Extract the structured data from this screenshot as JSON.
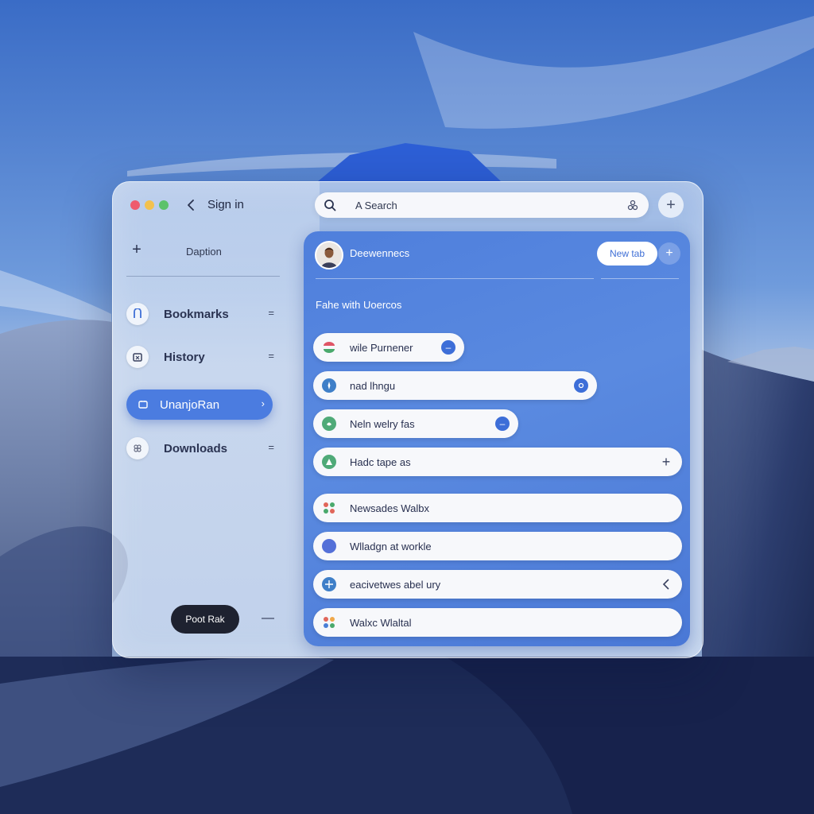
{
  "window": {
    "signin_label": "Sign in"
  },
  "sidebar": {
    "title": "Daption",
    "items": [
      {
        "label": "Bookmarks",
        "icon": "bookmark-icon",
        "trail": "="
      },
      {
        "label": "History",
        "icon": "history-icon",
        "trail": "="
      },
      {
        "label": "UnanjoRan",
        "icon": "folder-icon",
        "trail": "›"
      },
      {
        "label": "Downloads",
        "icon": "download-icon",
        "trail": "="
      }
    ],
    "post_button": "Poot Rak"
  },
  "search": {
    "placeholder": "A Search"
  },
  "panel": {
    "title": "Deewennecs",
    "new_tab_label": "New tab",
    "section_heading": "Fahe with Uoercos",
    "rows": [
      {
        "label": "wile Purnener",
        "icon": "chrome-icon",
        "action": "minus-icon"
      },
      {
        "label": "nad lhngu",
        "icon": "compass-icon",
        "action": "target-icon"
      },
      {
        "label": "Neln welry fas",
        "icon": "leaf-icon",
        "action": "minus-icon"
      },
      {
        "label": "Hadc tape as",
        "icon": "triangle-icon",
        "action": "plus-icon"
      },
      {
        "label": "Newsades Walbx",
        "icon": "apps-icon",
        "action": ""
      },
      {
        "label": "Wlladgn at workle",
        "icon": "circle-icon",
        "action": ""
      },
      {
        "label": "eacivetwes abel ury",
        "icon": "compass-icon",
        "action": "chevron-left-icon"
      },
      {
        "label": "Walxc Wlaltal",
        "icon": "apps-icon",
        "action": ""
      }
    ]
  },
  "colors": {
    "accent": "#4b7ce0",
    "panel": "#5a8ae0",
    "traffic_red": "#ee5a6e",
    "traffic_yellow": "#f2c14e",
    "traffic_green": "#5cc26b"
  }
}
